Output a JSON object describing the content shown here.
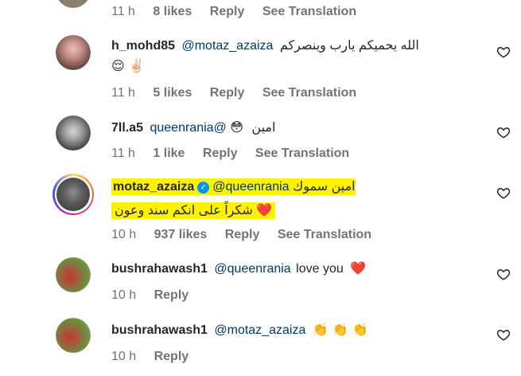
{
  "comments": [
    {
      "username": "",
      "mention": "",
      "text": "",
      "time": "11 h",
      "likes": "8 likes",
      "reply": "Reply",
      "translate": "See Translation"
    },
    {
      "username": "h_mohd85",
      "mention": "@motaz_azaiza",
      "text": "الله يحميكم يارب وينصركم",
      "emoji": "😌 ✌🏻",
      "time": "11 h",
      "likes": "5 likes",
      "reply": "Reply",
      "translate": "See Translation"
    },
    {
      "username": "7ll.a5",
      "mention": "queenrania@",
      "text": "امين",
      "emoji": "😳",
      "time": "11 h",
      "likes": "1 like",
      "reply": "Reply",
      "translate": "See Translation"
    },
    {
      "username": "motaz_azaiza",
      "mention": "@queenrania",
      "text": "امين سموك",
      "text2": "شكراً على انكم سند وعون",
      "emoji2": "❤️",
      "time": "10 h",
      "likes": "937 likes",
      "reply": "Reply",
      "translate": "See Translation"
    },
    {
      "username": "bushrahawash1",
      "mention": "@queenrania",
      "text": "love you",
      "emoji": "❤️",
      "time": "10 h",
      "reply": "Reply"
    },
    {
      "username": "bushrahawash1",
      "mention": "@motaz_azaiza",
      "emoji": "👏 👏 👏",
      "time": "10 h",
      "reply": "Reply"
    }
  ]
}
